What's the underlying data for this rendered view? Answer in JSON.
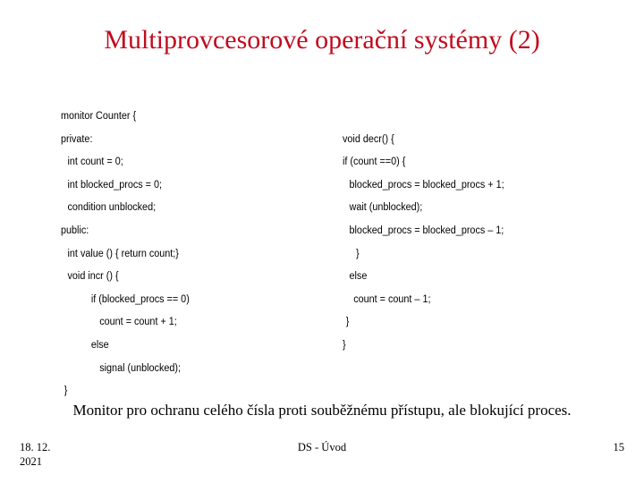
{
  "slide": {
    "title": "Multiprovcesorové operační systémy (2)",
    "title_color": "#c00b1e",
    "caption": "Monitor pro ochranu celého čísla proti souběžnému přístupu, ale blokující proces.",
    "text_color": "#000000",
    "background": "#ffffff"
  },
  "code": {
    "left_column": [
      {
        "text": "monitor Counter {",
        "indent": "ind-0"
      },
      {
        "text": "private:",
        "indent": "ind-0"
      },
      {
        "text": "int count = 0;",
        "indent": "ind-1"
      },
      {
        "text": "int blocked_procs = 0;",
        "indent": "ind-1"
      },
      {
        "text": "condition unblocked;",
        "indent": "ind-1"
      },
      {
        "text": "public:",
        "indent": "ind-0"
      },
      {
        "text": "int value () { return count;}",
        "indent": "ind-1"
      },
      {
        "text": "void incr () {",
        "indent": "ind-1"
      },
      {
        "text": "if (blocked_procs == 0)",
        "indent": "ind-25"
      },
      {
        "text": "count = count + 1;",
        "indent": "ind-3"
      },
      {
        "text": "else",
        "indent": "ind-25"
      },
      {
        "text": "signal (unblocked);",
        "indent": "ind-3"
      },
      {
        "text": "}",
        "indent": "ind-m"
      }
    ],
    "right_column": [
      {
        "text": "",
        "indent": "ind-0",
        "spacer": true
      },
      {
        "text": "void decr() {",
        "indent": "ind-0"
      },
      {
        "text": "if (count ==0) {",
        "indent": "ind-0"
      },
      {
        "text": "blocked_procs = blocked_procs + 1;",
        "indent": "ind-1"
      },
      {
        "text": "wait (unblocked);",
        "indent": "ind-1"
      },
      {
        "text": "blocked_procs = blocked_procs – 1;",
        "indent": "ind-1"
      },
      {
        "text": "}",
        "indent": "ind-15"
      },
      {
        "text": "else",
        "indent": "ind-1"
      },
      {
        "text": "count = count – 1;",
        "indent": "ind-12"
      },
      {
        "text": "}",
        "indent": "ind-05"
      },
      {
        "text": "}",
        "indent": "ind-0"
      }
    ]
  },
  "footer": {
    "date_line1": "18. 12.",
    "date_line2": "2021",
    "center": "DS - Úvod",
    "page_number": "15"
  }
}
